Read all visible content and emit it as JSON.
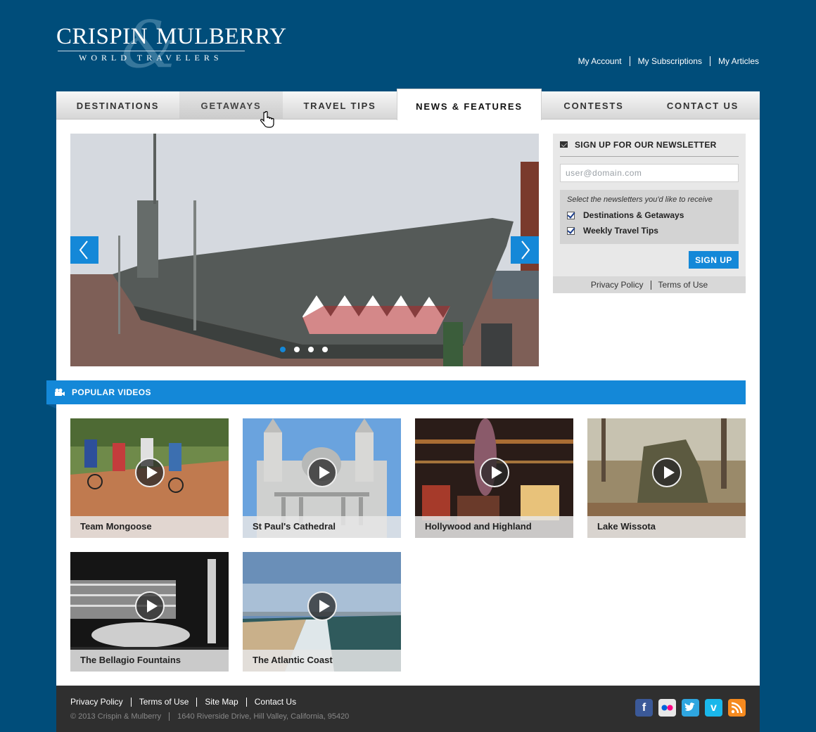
{
  "brand": {
    "name_first": "CRISPIN",
    "name_second": "MULBERRY",
    "ampersand": "&",
    "tagline": "WORLD TRAVELERS"
  },
  "account_links": [
    "My Account",
    "My Subscriptions",
    "My Articles"
  ],
  "nav": {
    "tabs": [
      {
        "label": "DESTINATIONS",
        "state": "default"
      },
      {
        "label": "GETAWAYS",
        "state": "hover"
      },
      {
        "label": "TRAVEL TIPS",
        "state": "default"
      },
      {
        "label": "NEWS & FEATURES",
        "state": "active"
      },
      {
        "label": "CONTESTS",
        "state": "default"
      },
      {
        "label": "CONTACT US",
        "state": "default"
      }
    ]
  },
  "slider": {
    "slide_count": 4,
    "active_slide": 1
  },
  "newsletter": {
    "title": "SIGN UP FOR OUR NEWSLETTER",
    "email_placeholder": "user@domain.com",
    "hint": "Select the newsletters you'd like to receive",
    "options": [
      {
        "label": "Destinations & Getaways",
        "checked": true
      },
      {
        "label": "Weekly Travel Tips",
        "checked": true
      }
    ],
    "button": "SIGN UP",
    "links": [
      "Privacy Policy",
      "Terms of Use"
    ]
  },
  "popular_videos": {
    "title": "POPULAR VIDEOS",
    "items": [
      {
        "title": "Team Mongoose"
      },
      {
        "title": "St Paul's Cathedral"
      },
      {
        "title": "Hollywood and Highland"
      },
      {
        "title": "Lake Wissota"
      },
      {
        "title": "The Bellagio Fountains"
      },
      {
        "title": "The Atlantic Coast"
      }
    ]
  },
  "footer": {
    "links": [
      "Privacy Policy",
      "Terms of Use",
      "Site Map",
      "Contact Us"
    ],
    "copyright": "© 2013 Crispin & Mulberry",
    "address": "1640 Riverside Drive, Hill Valley, California, 95420",
    "social": [
      "facebook-icon",
      "flickr-icon",
      "twitter-icon",
      "vimeo-icon",
      "rss-icon"
    ]
  },
  "colors": {
    "background": "#004d7a",
    "accent": "#1488d8",
    "footer": "#2f2f2f"
  }
}
